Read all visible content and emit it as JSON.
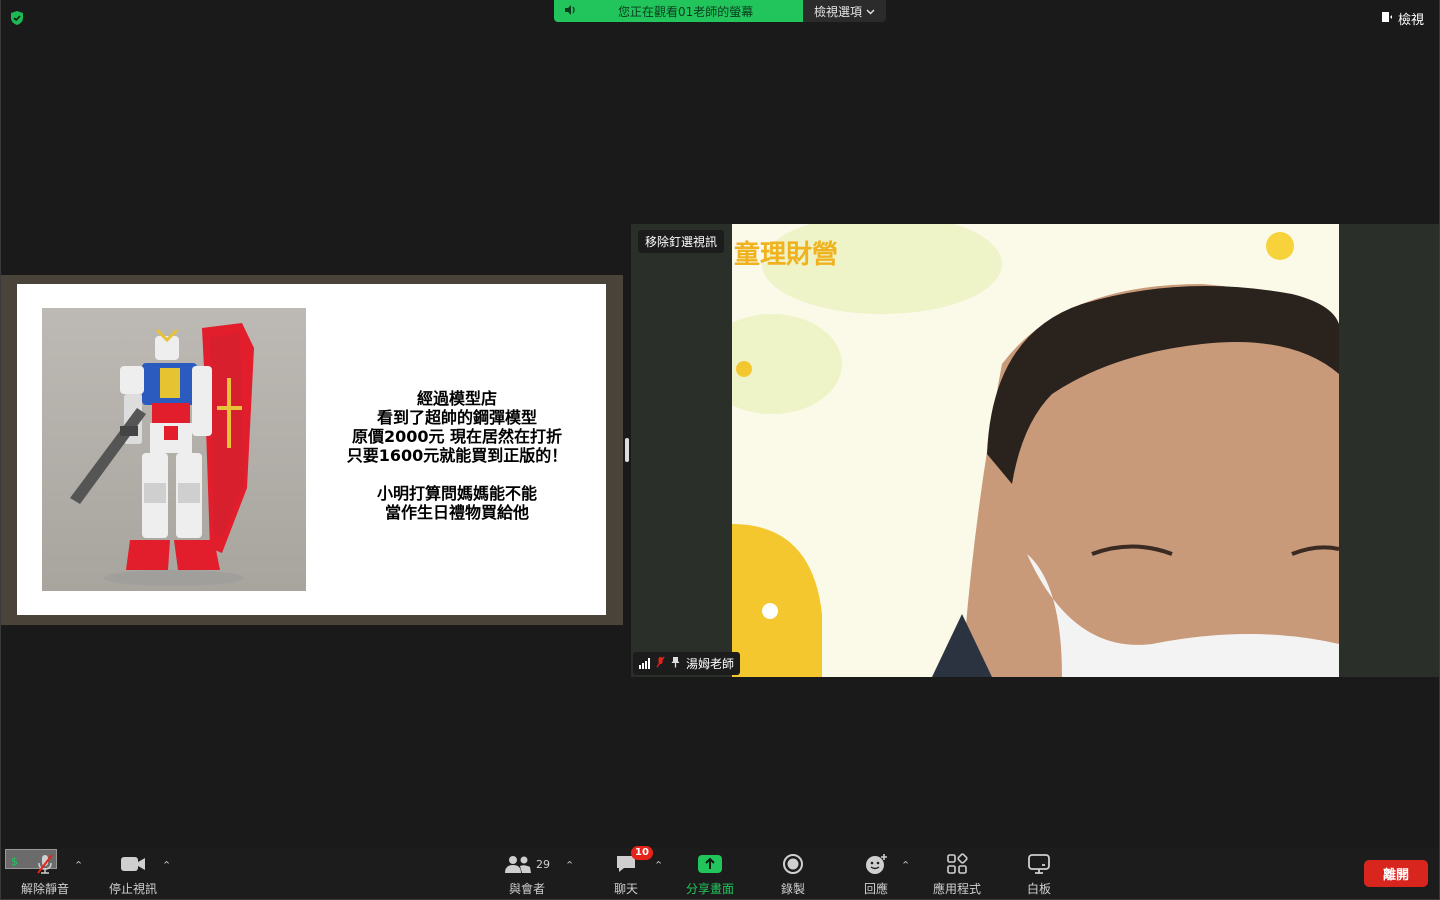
{
  "top": {
    "share_banner": "您正在觀看01老師的螢幕",
    "view_options": "檢視選項",
    "view_button": "檢視"
  },
  "slide": {
    "lines_block1": [
      "經過模型店",
      "看到了超帥的鋼彈模型",
      "原價2000元 現在居然在打折",
      "只要1600元就能買到正版的！"
    ],
    "lines_block2": [
      "小明打算問媽媽能不能",
      "當作生日禮物買給他"
    ]
  },
  "video": {
    "unpin_button": "移除釘選視訊",
    "participant_name": "湯姆老師",
    "background_title": "童理財營"
  },
  "toolbar": {
    "unmute": "解除靜音",
    "stop_video": "停止視訊",
    "participants": "與會者",
    "participants_count": "29",
    "chat": "聊天",
    "chat_badge": "10",
    "share_screen": "分享畫面",
    "record": "錄製",
    "reactions": "回應",
    "apps": "應用程式",
    "whiteboard": "白板",
    "leave": "離開"
  },
  "colors": {
    "share_green": "#21c55b",
    "leave_red": "#d8261e",
    "toolbar_bg": "#1c1c1c"
  }
}
